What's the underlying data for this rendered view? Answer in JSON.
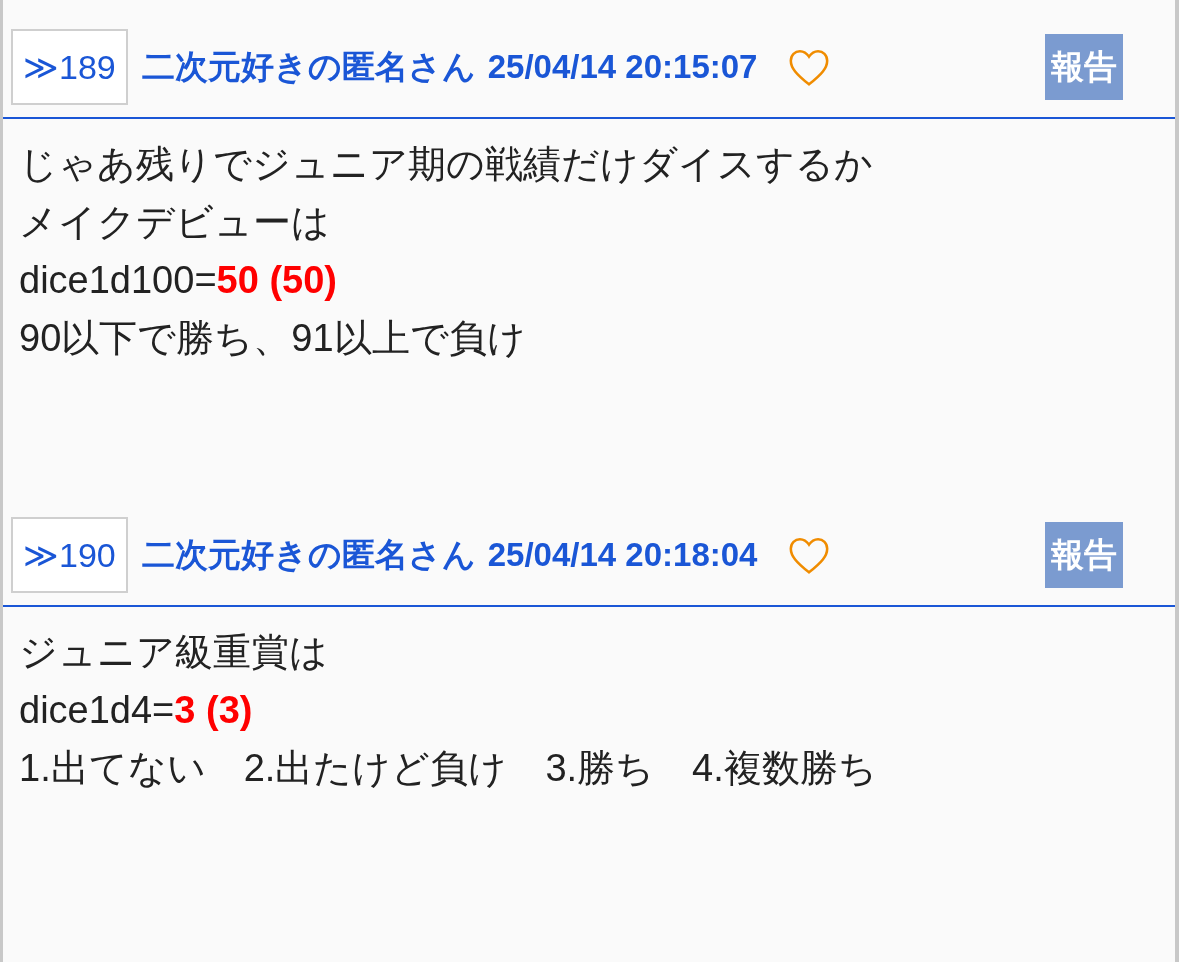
{
  "posts": [
    {
      "number": "≫189",
      "author": "二次元好きの匿名さん",
      "date": "25/04/14 20:15:07",
      "report": "報告",
      "lines": [
        "じゃあ残りでジュニア期の戦績だけダイスするか",
        "メイクデビューは",
        "dice1d100=**50 (50)**",
        "90以下で勝ち、91以上で負け"
      ]
    },
    {
      "number": "≫190",
      "author": "二次元好きの匿名さん",
      "date": "25/04/14 20:18:04",
      "report": "報告",
      "lines": [
        "ジュニア級重賞は",
        "dice1d4=**3 (3)**",
        "1.出てない　2.出たけど負け　3.勝ち　4.複数勝ち"
      ]
    }
  ]
}
